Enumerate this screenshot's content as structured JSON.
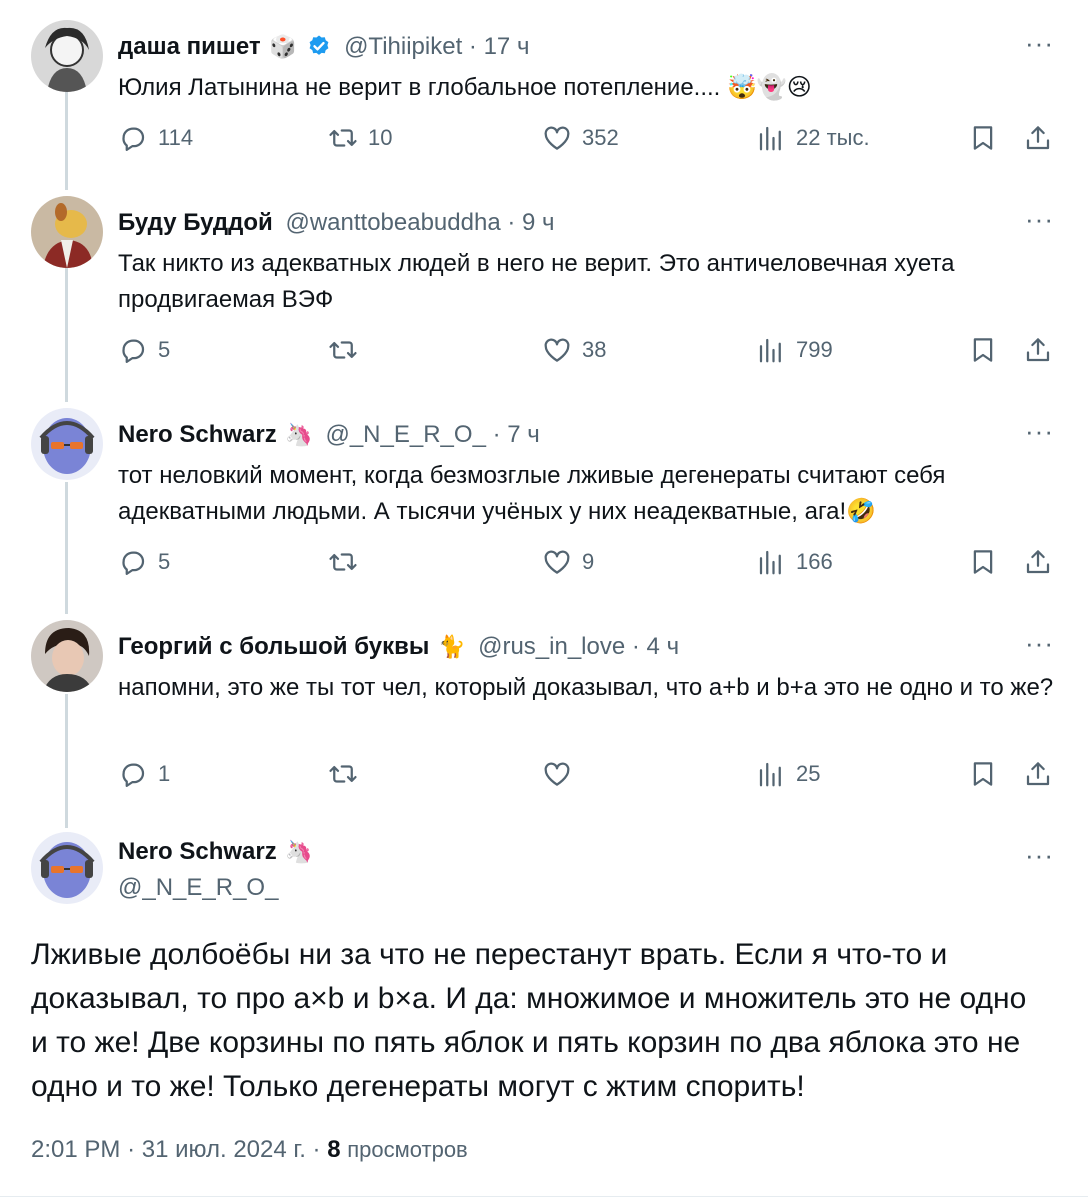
{
  "tweets": [
    {
      "name": "даша пишет",
      "badge": "🎲",
      "verified": true,
      "handle": "@Tihiipiket",
      "time": "17 ч",
      "text": "Юлия Латынина не верит в глобальное потепление.... 🤯👻😢",
      "replies": "114",
      "retweets": "10",
      "likes": "352",
      "views": "22 тыс."
    },
    {
      "name": "Буду Буддой",
      "badge": "",
      "verified": false,
      "handle": "@wanttobeabuddha",
      "time": "9 ч",
      "text": "Так никто из адекватных людей в него не верит. Это античеловечная хуета продвигаемая ВЭФ",
      "replies": "5",
      "retweets": "",
      "likes": "38",
      "views": "799"
    },
    {
      "name": "Nero Schwarz",
      "badge": "🦄",
      "verified": false,
      "handle": "@_N_E_R_O_",
      "time": "7 ч",
      "text": "тот неловкий момент, когда безмозглые лживые дегенераты считают себя адекватными людьми. А тысячи учёных у них неадекватные, ага!🤣",
      "replies": "5",
      "retweets": "",
      "likes": "9",
      "views": "166"
    },
    {
      "name": "Георгий с большой буквы",
      "badge": "🐈",
      "verified": false,
      "handle": "@rus_in_love",
      "time": "4 ч",
      "text": "напомни, это же ты тот чел, который доказывал, что a+b и b+a это не одно и то же?",
      "replies": "1",
      "retweets": "",
      "likes": "",
      "views": "25"
    }
  ],
  "main": {
    "name": "Nero Schwarz",
    "badge": "🦄",
    "handle": "@_N_E_R_O_",
    "text": "Лживые долбоёбы ни за что не перестанут врать. Если я что-то и доказывал, то про a×b и b×a. И да: множимое и множитель это не одно и то же! Две корзины по пять яблок и пять корзин по два яблока это не одно и то же! Только дегенераты могут с жтим спорить!",
    "time": "2:01 PM",
    "date": "31 июл. 2024 г.",
    "views_count": "8",
    "views_label": "просмотров"
  },
  "more_label": "···",
  "separator": "·",
  "colors": {
    "text": "#0f1419",
    "muted": "#536471",
    "verified": "#1d9bf0",
    "line": "#cfd9de"
  }
}
